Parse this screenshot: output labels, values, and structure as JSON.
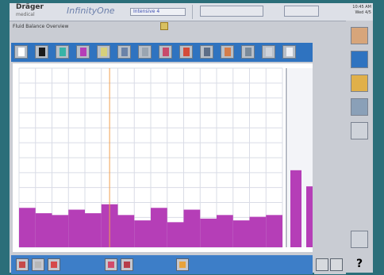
{
  "header": {
    "logo_brand": "Dräger",
    "logo_sub": "medical",
    "title": "InfinityOne",
    "patient_dropdown": "Intensive 4",
    "clock_line1": "10:45 AM",
    "clock_line2": "Wed 4/5"
  },
  "panel": {
    "label": "Fluid Balance Overview"
  },
  "icons": {
    "toolbar": [
      "fluid-icon",
      "drop-icon",
      "syringe-icon",
      "wrench-icon",
      "bag-icon",
      "note-icon",
      "close-cross-icon",
      "tube-icon",
      "blood-icon",
      "pill-icon",
      "tube-icon",
      "chart-icon",
      "table-icon",
      "monitor-icon"
    ],
    "right": [
      "triangle-icon",
      "arc-icon",
      "calendar-icon",
      "trend-icon",
      "print-icon"
    ],
    "bottom": [
      "paper-icon",
      "folder-icon",
      "flag-icon",
      "tray-icon",
      "scale-icon",
      "lamp-icon"
    ],
    "bottom_right": [
      "clock-icon",
      "clock-alt-icon",
      "help-icon"
    ],
    "bottom_right_help_text": "?"
  },
  "chart_data": {
    "type": "bar",
    "categories": [
      "",
      "",
      "",
      "",
      "",
      "",
      "",
      "",
      "",
      "",
      "",
      "",
      "",
      "",
      "",
      ""
    ],
    "values": [
      22,
      19,
      18,
      21,
      19,
      24,
      18,
      15,
      22,
      14,
      21,
      16,
      18,
      15,
      17,
      18
    ],
    "extra_bars": [
      {
        "value": 43
      },
      {
        "value": 34
      }
    ],
    "ylim": [
      0,
      100
    ],
    "grid": true,
    "series_color": "#b53eb7",
    "cursor_color": "#f0a050"
  }
}
